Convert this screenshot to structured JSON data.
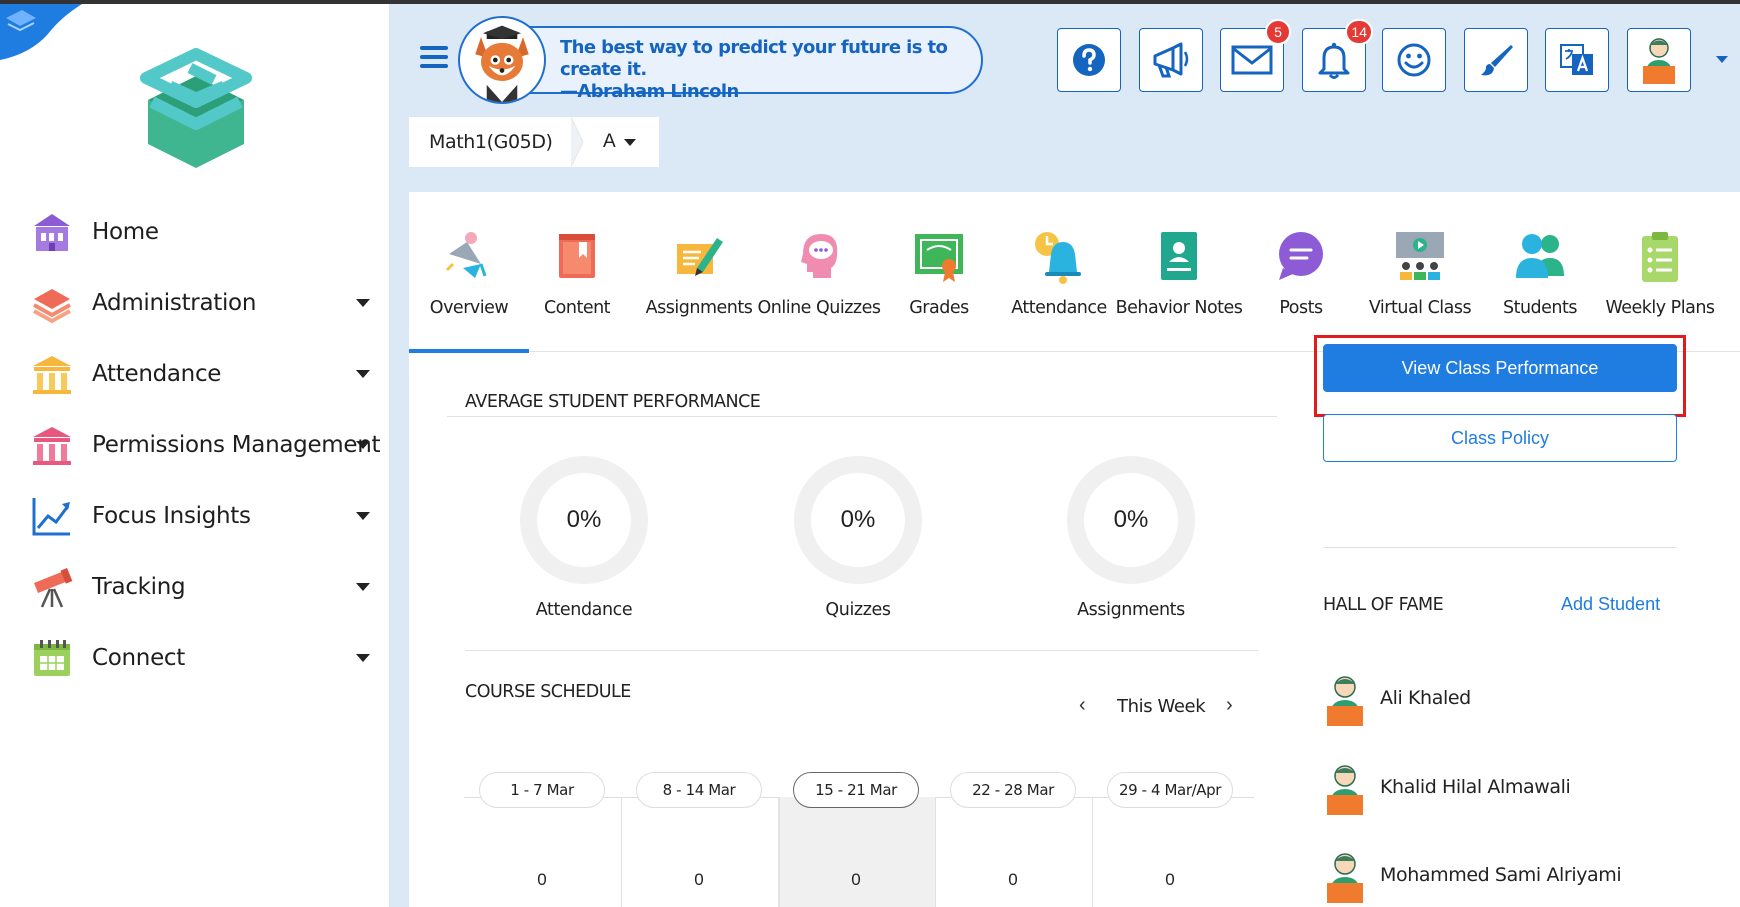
{
  "sidebar": {
    "items": [
      {
        "label": "Home",
        "icon": "home-icon",
        "has_caret": false
      },
      {
        "label": "Administration",
        "icon": "layers-icon",
        "has_caret": true
      },
      {
        "label": "Attendance",
        "icon": "columns-building-icon",
        "has_caret": true
      },
      {
        "label": "Permissions Management",
        "icon": "pink-building-icon",
        "has_caret": true
      },
      {
        "label": "Focus Insights",
        "icon": "trend-chart-icon",
        "has_caret": true
      },
      {
        "label": "Tracking",
        "icon": "telescope-icon",
        "has_caret": true
      },
      {
        "label": "Connect",
        "icon": "calendar-icon",
        "has_caret": true
      }
    ]
  },
  "header": {
    "quote_line1": "The best way to predict your future is to create it.",
    "quote_line2": "—Abraham Lincoln",
    "messages_count": "5",
    "notifications_count": "14",
    "buttons": [
      "help-icon",
      "megaphone-icon",
      "mail-icon",
      "bell-icon",
      "smiley-icon",
      "brush-icon",
      "translate-icon",
      "user-avatar-icon"
    ]
  },
  "course": {
    "name": "Math1(G05D)",
    "section": "A"
  },
  "tabs": [
    {
      "label": "Overview",
      "icon": "lamp-icon",
      "active": true
    },
    {
      "label": "Content",
      "icon": "book-icon"
    },
    {
      "label": "Assignments",
      "icon": "pen-paper-icon"
    },
    {
      "label": "Online Quizzes",
      "icon": "head-bubble-icon"
    },
    {
      "label": "Grades",
      "icon": "certificate-icon"
    },
    {
      "label": "Attendance",
      "icon": "alarm-bell-icon"
    },
    {
      "label": "Behavior Notes",
      "icon": "id-card-icon"
    },
    {
      "label": "Posts",
      "icon": "chat-bubble-icon"
    },
    {
      "label": "Virtual Class",
      "icon": "presentation-icon"
    },
    {
      "label": "Students",
      "icon": "people-icon"
    },
    {
      "label": "Weekly Plans",
      "icon": "clipboard-list-icon"
    }
  ],
  "performance": {
    "title": "AVERAGE STUDENT PERFORMANCE",
    "metrics": [
      {
        "label": "Attendance",
        "value": "0%"
      },
      {
        "label": "Quizzes",
        "value": "0%"
      },
      {
        "label": "Assignments",
        "value": "0%"
      }
    ]
  },
  "schedule": {
    "title": "COURSE SCHEDULE",
    "week_label": "This Week",
    "prev": "‹",
    "next": "›",
    "weeks": [
      {
        "range": "1 - 7 Mar",
        "count": "0"
      },
      {
        "range": "8 - 14 Mar",
        "count": "0"
      },
      {
        "range": "15 - 21 Mar",
        "count": "0",
        "current": true
      },
      {
        "range": "22 - 28 Mar",
        "count": "0"
      },
      {
        "range": "29 - 4 Mar/Apr",
        "count": "0"
      }
    ]
  },
  "actions": {
    "view_performance": "View Class Performance",
    "class_policy": "Class Policy"
  },
  "hall_of_fame": {
    "title": "HALL OF FAME",
    "add_label": "Add Student",
    "students": [
      "Ali Khaled",
      "Khalid Hilal Almawali",
      "Mohammed Sami Alriyami"
    ]
  },
  "colors": {
    "primary": "#1f7ce0",
    "highlight": "#e01b1b",
    "badge": "#e53935"
  }
}
